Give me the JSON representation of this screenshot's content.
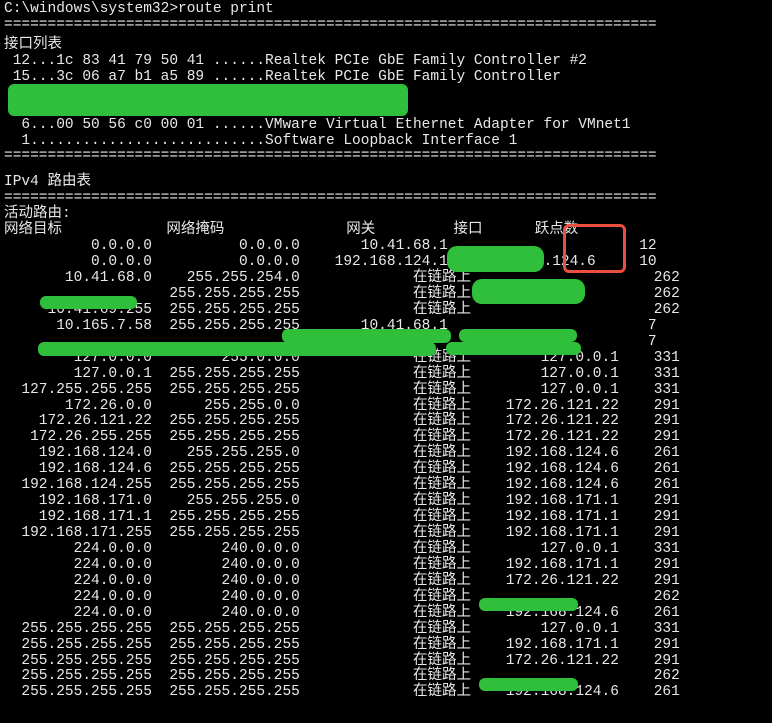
{
  "prompt": "C:\\windows\\system32>",
  "command": "route print",
  "separator": "===========================================================================",
  "ifaces_header": "接口列表",
  "ifaces": [
    " 12...1c 83 41 79 50 41 ......Realtek PCIe GbE Family Controller #2",
    " 15...3c 06 a7 b1 a5 89 ......Realtek PCIe GbE Family Controller",
    "                                                  ",
    "                                                  ",
    "  6...00 50 56 c0 00 01 ......VMware Virtual Ethernet Adapter for VMnet1",
    "  1...........................Software Loopback Interface 1"
  ],
  "ipv4_header": "IPv4 路由表",
  "active_header": "活动路由:",
  "cols": {
    "dest": "网络目标",
    "mask": "网络掩码",
    "gw": "网关",
    "iface": "接口",
    "metric": "跃点数"
  },
  "on_link": "在链路上",
  "rows": [
    {
      "d": "0.0.0.0",
      "m": "0.0.0.0",
      "g": "10.41.68.1",
      "i": "",
      "t": "12",
      "hi": true
    },
    {
      "d": "0.0.0.0",
      "m": "0.0.0.0",
      "g": "192.168.124.1",
      "i": "192.168.124.6",
      "t": "10",
      "hi": true
    },
    {
      "d": "10.41.68.0",
      "m": "255.255.254.0",
      "g": "在链路上",
      "i": "",
      "t": "262"
    },
    {
      "d": "",
      "m": "255.255.255.255",
      "g": "在链路上",
      "i": "",
      "t": "262"
    },
    {
      "d": "10.41.69.255",
      "m": "255.255.255.255",
      "g": "在链路上",
      "i": "",
      "t": "262"
    },
    {
      "d": "10.165.7.58",
      "m": "255.255.255.255",
      "g": "10.41.68.1",
      "i": "",
      "t": "7"
    },
    {
      "d": "",
      "m": "",
      "g": "",
      "i": "",
      "t": "7"
    },
    {
      "d": "127.0.0.0",
      "m": "255.0.0.0",
      "g": "在链路上",
      "i": "127.0.0.1",
      "t": "331"
    },
    {
      "d": "127.0.0.1",
      "m": "255.255.255.255",
      "g": "在链路上",
      "i": "127.0.0.1",
      "t": "331"
    },
    {
      "d": "127.255.255.255",
      "m": "255.255.255.255",
      "g": "在链路上",
      "i": "127.0.0.1",
      "t": "331"
    },
    {
      "d": "172.26.0.0",
      "m": "255.255.0.0",
      "g": "在链路上",
      "i": "172.26.121.22",
      "t": "291"
    },
    {
      "d": "172.26.121.22",
      "m": "255.255.255.255",
      "g": "在链路上",
      "i": "172.26.121.22",
      "t": "291"
    },
    {
      "d": "172.26.255.255",
      "m": "255.255.255.255",
      "g": "在链路上",
      "i": "172.26.121.22",
      "t": "291"
    },
    {
      "d": "192.168.124.0",
      "m": "255.255.255.0",
      "g": "在链路上",
      "i": "192.168.124.6",
      "t": "261"
    },
    {
      "d": "192.168.124.6",
      "m": "255.255.255.255",
      "g": "在链路上",
      "i": "192.168.124.6",
      "t": "261"
    },
    {
      "d": "192.168.124.255",
      "m": "255.255.255.255",
      "g": "在链路上",
      "i": "192.168.124.6",
      "t": "261"
    },
    {
      "d": "192.168.171.0",
      "m": "255.255.255.0",
      "g": "在链路上",
      "i": "192.168.171.1",
      "t": "291"
    },
    {
      "d": "192.168.171.1",
      "m": "255.255.255.255",
      "g": "在链路上",
      "i": "192.168.171.1",
      "t": "291"
    },
    {
      "d": "192.168.171.255",
      "m": "255.255.255.255",
      "g": "在链路上",
      "i": "192.168.171.1",
      "t": "291"
    },
    {
      "d": "224.0.0.0",
      "m": "240.0.0.0",
      "g": "在链路上",
      "i": "127.0.0.1",
      "t": "331"
    },
    {
      "d": "224.0.0.0",
      "m": "240.0.0.0",
      "g": "在链路上",
      "i": "192.168.171.1",
      "t": "291"
    },
    {
      "d": "224.0.0.0",
      "m": "240.0.0.0",
      "g": "在链路上",
      "i": "172.26.121.22",
      "t": "291"
    },
    {
      "d": "224.0.0.0",
      "m": "240.0.0.0",
      "g": "在链路上",
      "i": "",
      "t": "262"
    },
    {
      "d": "224.0.0.0",
      "m": "240.0.0.0",
      "g": "在链路上",
      "i": "192.168.124.6",
      "t": "261"
    },
    {
      "d": "255.255.255.255",
      "m": "255.255.255.255",
      "g": "在链路上",
      "i": "127.0.0.1",
      "t": "331"
    },
    {
      "d": "255.255.255.255",
      "m": "255.255.255.255",
      "g": "在链路上",
      "i": "192.168.171.1",
      "t": "291"
    },
    {
      "d": "255.255.255.255",
      "m": "255.255.255.255",
      "g": "在链路上",
      "i": "172.26.121.22",
      "t": "291"
    },
    {
      "d": "255.255.255.255",
      "m": "255.255.255.255",
      "g": "在链路上",
      "i": "",
      "t": "262"
    },
    {
      "d": "255.255.255.255",
      "m": "255.255.255.255",
      "g": "在链路上",
      "i": "192.168.124.6",
      "t": "261"
    }
  ]
}
